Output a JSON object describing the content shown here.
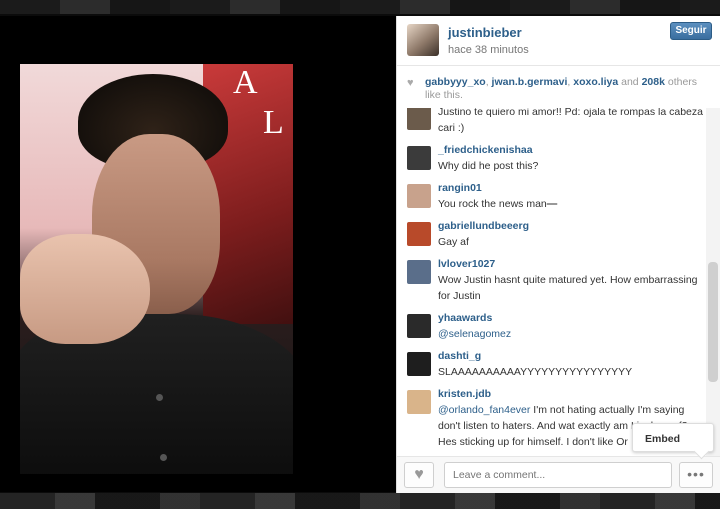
{
  "post": {
    "username": "justinbieber",
    "time": "hace 38 minutos",
    "follow_label": "Seguir",
    "likes": {
      "users": [
        "gabbyyy_xo",
        "jwan.b.germavi",
        "xoxo.liya"
      ],
      "and_text": "and",
      "count": "208k",
      "suffix": "others like this."
    },
    "photo_sign_letters": [
      "A",
      "L"
    ]
  },
  "comments": [
    {
      "user": "",
      "text": "Justino te quiero mi amor!! Pd: ojala te rompas la cabeza cari :)",
      "color": "#6b5b4b"
    },
    {
      "user": "_friedchickenishaa",
      "text": "Why did he post this?",
      "color": "#3b3b3b"
    },
    {
      "user": "rangin01",
      "text": "You rock the news man⎯⎯",
      "color": "#c8a28c"
    },
    {
      "user": "gabriellundbeeerg",
      "text": "Gay af",
      "color": "#b84a2a"
    },
    {
      "user": "lvlover1027",
      "text": "Wow Justin hasnt quite matured yet. How embarrassing for Justin",
      "color": "#5a6e8a"
    },
    {
      "user": "yhaawards",
      "mention": "@selenagomez",
      "text": "",
      "color": "#2a2a2a"
    },
    {
      "user": "dashti_g",
      "text": "SLAAAAAAAAAAYYYYYYYYYYYYYYYY",
      "color": "#1e1e1e"
    },
    {
      "user": "kristen.jdb",
      "mention": "@orlando_fan4ever",
      "text": " I'm not hating actually I'm saying don't listen to haters. And wat exactly am I jealous of? Hes sticking up for himself. I don't like Or",
      "color": "#d9b48a"
    }
  ],
  "footer": {
    "comment_placeholder": "Leave a comment...",
    "heart_icon": "heart-icon",
    "more_icon": "more-icon",
    "more_label": "•••"
  },
  "embed_label": "Embed",
  "colors": {
    "link": "#2d5f8a",
    "follow_button": "#3a6e9f"
  }
}
